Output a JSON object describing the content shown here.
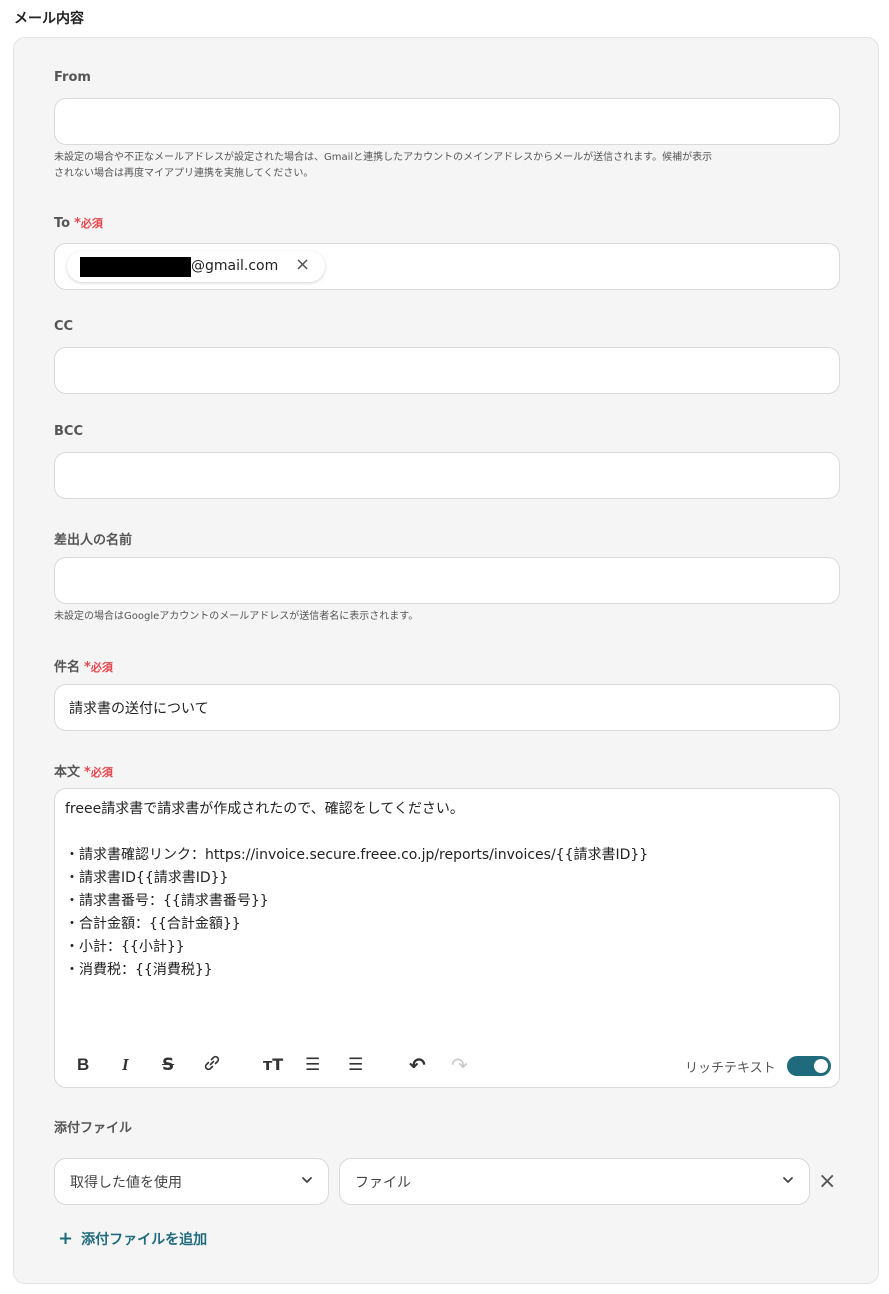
{
  "section_title": "メール内容",
  "from": {
    "label": "From",
    "value": "",
    "help_line1": "未設定の場合や不正なメールアドレスが設定された場合は、Gmailと連携したアカウントのメインアドレスからメールが送信されます。候補が表示",
    "help_line2": "されない場合は再度マイアプリ連携を実施してください。"
  },
  "to": {
    "label": "To",
    "required_star": "*",
    "required_text": "必須",
    "chip_text": "@gmail.com",
    "chip_remove": "×"
  },
  "cc": {
    "label": "CC",
    "value": ""
  },
  "bcc": {
    "label": "BCC",
    "value": ""
  },
  "sender_name": {
    "label": "差出人の名前",
    "value": "",
    "help": "未設定の場合はGoogleアカウントのメールアドレスが送信者名に表示されます。"
  },
  "subject": {
    "label": "件名",
    "required_star": "*",
    "required_text": "必須",
    "value": "請求書の送付について"
  },
  "body": {
    "label": "本文",
    "required_star": "*",
    "required_text": "必須",
    "lines": [
      "freee請求書で請求書が作成されたので、確認をしてください。",
      "",
      "・請求書確認リンク：https://invoice.secure.freee.co.jp/reports/invoices/{{請求書ID}}",
      "・請求書ID{{請求書ID}}",
      "・請求書番号：{{請求書番号}}",
      "・合計金額：{{合計金額}}",
      "・小計：{{小計}}",
      "・消費税：{{消費税}}"
    ],
    "toolbar": {
      "bold": "B",
      "italic": "I",
      "strike": "S",
      "link": "🔗",
      "text_size": "тT",
      "bullet_list": "☰",
      "numbered_list": "☰",
      "undo": "↶",
      "redo": "↷"
    },
    "rich_text_label": "リッチテキスト",
    "rich_text_enabled": true
  },
  "attachment": {
    "label": "添付ファイル",
    "source_select": "取得した値を使用",
    "file_select": "ファイル",
    "remove": "×",
    "add_plus": "+",
    "add_label": "添付ファイルを追加"
  },
  "colors": {
    "accent": "#1f6b7d",
    "required": "#e5484d",
    "panel_bg": "#f5f5f5"
  }
}
